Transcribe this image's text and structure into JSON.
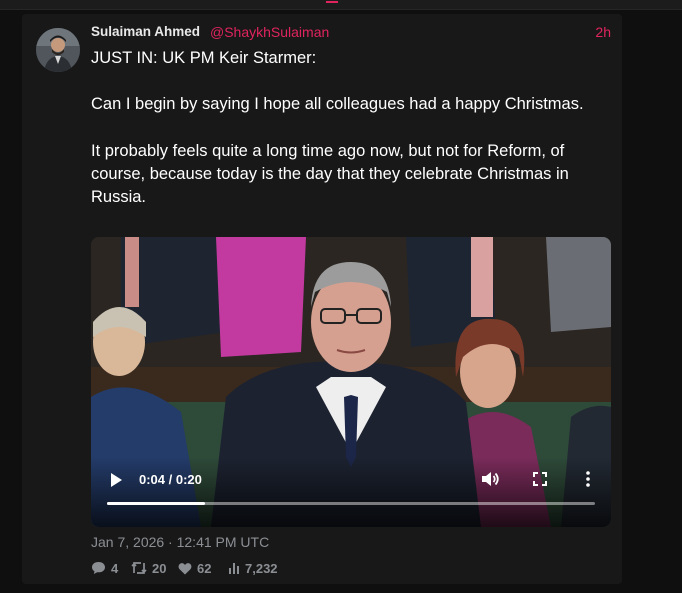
{
  "tweet": {
    "author_name": "Sulaiman Ahmed",
    "handle": "@ShaykhSulaiman",
    "relative_time": "2h",
    "paragraphs": [
      "JUST IN: UK PM Keir Starmer:",
      "Can I begin by saying I hope all colleagues had a happy Christmas.",
      "It probably feels quite a long time ago now, but not for Reform, of course, because today is the day that they celebrate Christmas in Russia."
    ],
    "date": "Jan 7, 2026 · 12:41 PM UTC"
  },
  "video": {
    "current_time": "0:04 / 0:20",
    "progress": 0.2
  },
  "stats": {
    "replies": "4",
    "retweets": "20",
    "likes": "62",
    "views": "7,232"
  },
  "icons": [
    "play-icon",
    "volume-icon",
    "fullscreen-icon",
    "more-icon",
    "reply-icon",
    "retweet-icon",
    "like-icon",
    "views-icon"
  ],
  "colors": {
    "accent": "#e0245e",
    "card_bg": "#181818",
    "muted": "#8b8f94"
  }
}
